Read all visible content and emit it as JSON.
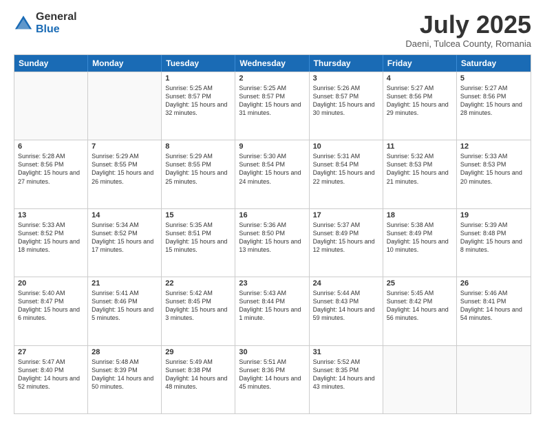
{
  "logo": {
    "general": "General",
    "blue": "Blue"
  },
  "title": "July 2025",
  "subtitle": "Daeni, Tulcea County, Romania",
  "header_days": [
    "Sunday",
    "Monday",
    "Tuesday",
    "Wednesday",
    "Thursday",
    "Friday",
    "Saturday"
  ],
  "rows": [
    [
      {
        "day": "",
        "empty": true
      },
      {
        "day": "",
        "empty": true
      },
      {
        "day": "1",
        "sunrise": "Sunrise: 5:25 AM",
        "sunset": "Sunset: 8:57 PM",
        "daylight": "Daylight: 15 hours and 32 minutes."
      },
      {
        "day": "2",
        "sunrise": "Sunrise: 5:25 AM",
        "sunset": "Sunset: 8:57 PM",
        "daylight": "Daylight: 15 hours and 31 minutes."
      },
      {
        "day": "3",
        "sunrise": "Sunrise: 5:26 AM",
        "sunset": "Sunset: 8:57 PM",
        "daylight": "Daylight: 15 hours and 30 minutes."
      },
      {
        "day": "4",
        "sunrise": "Sunrise: 5:27 AM",
        "sunset": "Sunset: 8:56 PM",
        "daylight": "Daylight: 15 hours and 29 minutes."
      },
      {
        "day": "5",
        "sunrise": "Sunrise: 5:27 AM",
        "sunset": "Sunset: 8:56 PM",
        "daylight": "Daylight: 15 hours and 28 minutes."
      }
    ],
    [
      {
        "day": "6",
        "sunrise": "Sunrise: 5:28 AM",
        "sunset": "Sunset: 8:56 PM",
        "daylight": "Daylight: 15 hours and 27 minutes."
      },
      {
        "day": "7",
        "sunrise": "Sunrise: 5:29 AM",
        "sunset": "Sunset: 8:55 PM",
        "daylight": "Daylight: 15 hours and 26 minutes."
      },
      {
        "day": "8",
        "sunrise": "Sunrise: 5:29 AM",
        "sunset": "Sunset: 8:55 PM",
        "daylight": "Daylight: 15 hours and 25 minutes."
      },
      {
        "day": "9",
        "sunrise": "Sunrise: 5:30 AM",
        "sunset": "Sunset: 8:54 PM",
        "daylight": "Daylight: 15 hours and 24 minutes."
      },
      {
        "day": "10",
        "sunrise": "Sunrise: 5:31 AM",
        "sunset": "Sunset: 8:54 PM",
        "daylight": "Daylight: 15 hours and 22 minutes."
      },
      {
        "day": "11",
        "sunrise": "Sunrise: 5:32 AM",
        "sunset": "Sunset: 8:53 PM",
        "daylight": "Daylight: 15 hours and 21 minutes."
      },
      {
        "day": "12",
        "sunrise": "Sunrise: 5:33 AM",
        "sunset": "Sunset: 8:53 PM",
        "daylight": "Daylight: 15 hours and 20 minutes."
      }
    ],
    [
      {
        "day": "13",
        "sunrise": "Sunrise: 5:33 AM",
        "sunset": "Sunset: 8:52 PM",
        "daylight": "Daylight: 15 hours and 18 minutes."
      },
      {
        "day": "14",
        "sunrise": "Sunrise: 5:34 AM",
        "sunset": "Sunset: 8:52 PM",
        "daylight": "Daylight: 15 hours and 17 minutes."
      },
      {
        "day": "15",
        "sunrise": "Sunrise: 5:35 AM",
        "sunset": "Sunset: 8:51 PM",
        "daylight": "Daylight: 15 hours and 15 minutes."
      },
      {
        "day": "16",
        "sunrise": "Sunrise: 5:36 AM",
        "sunset": "Sunset: 8:50 PM",
        "daylight": "Daylight: 15 hours and 13 minutes."
      },
      {
        "day": "17",
        "sunrise": "Sunrise: 5:37 AM",
        "sunset": "Sunset: 8:49 PM",
        "daylight": "Daylight: 15 hours and 12 minutes."
      },
      {
        "day": "18",
        "sunrise": "Sunrise: 5:38 AM",
        "sunset": "Sunset: 8:49 PM",
        "daylight": "Daylight: 15 hours and 10 minutes."
      },
      {
        "day": "19",
        "sunrise": "Sunrise: 5:39 AM",
        "sunset": "Sunset: 8:48 PM",
        "daylight": "Daylight: 15 hours and 8 minutes."
      }
    ],
    [
      {
        "day": "20",
        "sunrise": "Sunrise: 5:40 AM",
        "sunset": "Sunset: 8:47 PM",
        "daylight": "Daylight: 15 hours and 6 minutes."
      },
      {
        "day": "21",
        "sunrise": "Sunrise: 5:41 AM",
        "sunset": "Sunset: 8:46 PM",
        "daylight": "Daylight: 15 hours and 5 minutes."
      },
      {
        "day": "22",
        "sunrise": "Sunrise: 5:42 AM",
        "sunset": "Sunset: 8:45 PM",
        "daylight": "Daylight: 15 hours and 3 minutes."
      },
      {
        "day": "23",
        "sunrise": "Sunrise: 5:43 AM",
        "sunset": "Sunset: 8:44 PM",
        "daylight": "Daylight: 15 hours and 1 minute."
      },
      {
        "day": "24",
        "sunrise": "Sunrise: 5:44 AM",
        "sunset": "Sunset: 8:43 PM",
        "daylight": "Daylight: 14 hours and 59 minutes."
      },
      {
        "day": "25",
        "sunrise": "Sunrise: 5:45 AM",
        "sunset": "Sunset: 8:42 PM",
        "daylight": "Daylight: 14 hours and 56 minutes."
      },
      {
        "day": "26",
        "sunrise": "Sunrise: 5:46 AM",
        "sunset": "Sunset: 8:41 PM",
        "daylight": "Daylight: 14 hours and 54 minutes."
      }
    ],
    [
      {
        "day": "27",
        "sunrise": "Sunrise: 5:47 AM",
        "sunset": "Sunset: 8:40 PM",
        "daylight": "Daylight: 14 hours and 52 minutes."
      },
      {
        "day": "28",
        "sunrise": "Sunrise: 5:48 AM",
        "sunset": "Sunset: 8:39 PM",
        "daylight": "Daylight: 14 hours and 50 minutes."
      },
      {
        "day": "29",
        "sunrise": "Sunrise: 5:49 AM",
        "sunset": "Sunset: 8:38 PM",
        "daylight": "Daylight: 14 hours and 48 minutes."
      },
      {
        "day": "30",
        "sunrise": "Sunrise: 5:51 AM",
        "sunset": "Sunset: 8:36 PM",
        "daylight": "Daylight: 14 hours and 45 minutes."
      },
      {
        "day": "31",
        "sunrise": "Sunrise: 5:52 AM",
        "sunset": "Sunset: 8:35 PM",
        "daylight": "Daylight: 14 hours and 43 minutes."
      },
      {
        "day": "",
        "empty": true
      },
      {
        "day": "",
        "empty": true
      }
    ]
  ]
}
